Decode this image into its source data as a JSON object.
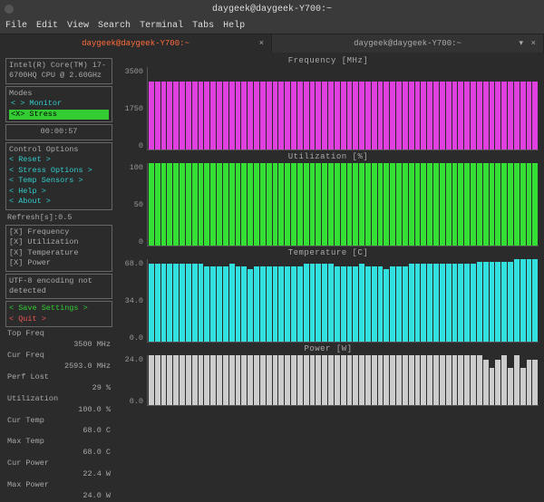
{
  "window_title": "daygeek@daygeek-Y700:~",
  "menu": [
    "File",
    "Edit",
    "View",
    "Search",
    "Terminal",
    "Tabs",
    "Help"
  ],
  "tabs": [
    {
      "label": "daygeek@daygeek-Y700:~",
      "active": true
    },
    {
      "label": "daygeek@daygeek-Y700:~",
      "active": false
    }
  ],
  "cpu_info": "Intel(R) Core(TM) i7-6700HQ CPU @ 2.60GHz",
  "modes": {
    "title": "Modes",
    "monitor": "< > Monitor",
    "stress": "<X> Stress"
  },
  "elapsed": "00:00:57",
  "control_options": {
    "title": "Control Options",
    "items": [
      "< Reset         >",
      "< Stress Options >",
      "< Temp Sensors  >",
      "< Help          >",
      "< About         >"
    ]
  },
  "refresh": "Refresh[s]:0.5",
  "toggles": [
    "[X] Frequency",
    "[X] Utilization",
    "[X] Temperature",
    "[X] Power"
  ],
  "encoding_msg": "UTF-8 encoding not detected",
  "save": "< Save Settings >",
  "quit": "< Quit >",
  "stats": [
    {
      "label": "Top Freq",
      "value": "3500 MHz"
    },
    {
      "label": "Cur Freq",
      "value": "2593.0 MHz"
    },
    {
      "label": "Perf Lost",
      "value": "29 %"
    },
    {
      "label": "Utilization",
      "value": "100.0 %"
    },
    {
      "label": "Cur Temp",
      "value": "68.0 C"
    },
    {
      "label": "Max Temp",
      "value": "68.0 C"
    },
    {
      "label": "Cur Power",
      "value": "22.4 W"
    },
    {
      "label": "Max Power",
      "value": "24.0 W"
    }
  ],
  "charts": {
    "freq": {
      "title": "Frequency [MHz]",
      "ticks": [
        "3500",
        "1750",
        "0"
      ]
    },
    "util": {
      "title": "Utilization [%]",
      "ticks": [
        "100",
        "50",
        "0"
      ]
    },
    "temp": {
      "title": "Temperature [C]",
      "ticks": [
        "68.0",
        "34.0",
        "0.0"
      ]
    },
    "power": {
      "title": "Power [W]",
      "ticks": [
        "24.0",
        "",
        "0.0"
      ]
    }
  },
  "chart_data": [
    {
      "type": "bar",
      "title": "Frequency [MHz]",
      "ylabel": "MHz",
      "ylim": [
        0,
        3500
      ],
      "values": [
        2900,
        2900,
        2900,
        2900,
        2900,
        2900,
        2900,
        2900,
        2900,
        2900,
        2900,
        2900,
        2900,
        2900,
        2900,
        2900,
        2900,
        2900,
        2900,
        2900,
        2900,
        2900,
        2900,
        2900,
        2900,
        2900,
        2900,
        2900,
        2900,
        2900,
        2900,
        2900,
        2900,
        2900,
        2900,
        2900,
        2900,
        2900,
        2900,
        2900,
        2900,
        2900,
        2900,
        2900,
        2900,
        2900,
        2900,
        2900,
        2900,
        2900,
        2900,
        2900,
        2900,
        2900,
        2900,
        2900,
        2900,
        2900,
        2900,
        2900,
        2900,
        2900,
        2900
      ]
    },
    {
      "type": "bar",
      "title": "Utilization [%]",
      "ylabel": "%",
      "ylim": [
        0,
        100
      ],
      "values": [
        100,
        100,
        100,
        100,
        100,
        100,
        100,
        100,
        100,
        100,
        100,
        100,
        100,
        100,
        100,
        100,
        100,
        100,
        100,
        100,
        100,
        100,
        100,
        100,
        100,
        100,
        100,
        100,
        100,
        100,
        100,
        100,
        100,
        100,
        100,
        100,
        100,
        100,
        100,
        100,
        100,
        100,
        100,
        100,
        100,
        100,
        100,
        100,
        100,
        100,
        100,
        100,
        100,
        100,
        100,
        100,
        100,
        100,
        100,
        100,
        100,
        100,
        100
      ]
    },
    {
      "type": "bar",
      "title": "Temperature [C]",
      "ylabel": "C",
      "ylim": [
        0,
        68
      ],
      "values": [
        64,
        64,
        64,
        64,
        64,
        64,
        64,
        64,
        64,
        62,
        62,
        62,
        62,
        64,
        62,
        62,
        60,
        62,
        62,
        62,
        62,
        62,
        62,
        62,
        62,
        64,
        64,
        64,
        64,
        64,
        62,
        62,
        62,
        62,
        64,
        62,
        62,
        62,
        60,
        62,
        62,
        62,
        64,
        64,
        64,
        64,
        64,
        64,
        64,
        64,
        64,
        64,
        64,
        66,
        66,
        66,
        66,
        66,
        66,
        68,
        68,
        68,
        68
      ]
    },
    {
      "type": "bar",
      "title": "Power [W]",
      "ylabel": "W",
      "ylim": [
        0,
        24
      ],
      "values": [
        24,
        24,
        24,
        24,
        24,
        24,
        24,
        24,
        24,
        24,
        24,
        24,
        24,
        24,
        24,
        24,
        24,
        24,
        24,
        24,
        24,
        24,
        24,
        24,
        24,
        24,
        24,
        24,
        24,
        24,
        24,
        24,
        24,
        24,
        24,
        24,
        24,
        24,
        24,
        24,
        24,
        24,
        24,
        24,
        24,
        24,
        24,
        24,
        24,
        24,
        24,
        24,
        24,
        24,
        22,
        18,
        22,
        24,
        18,
        24,
        18,
        22,
        22
      ]
    }
  ],
  "colors": {
    "freq": "#e040e0",
    "util": "#33e033",
    "temp": "#33e0e0",
    "power": "#cccccc"
  }
}
